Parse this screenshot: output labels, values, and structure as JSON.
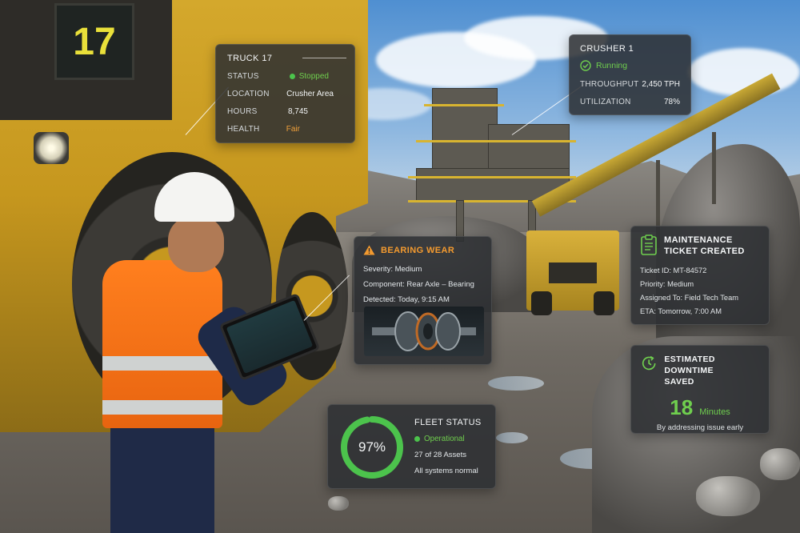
{
  "truck_plate": "17",
  "truck_panel": {
    "title": "TRUCK 17",
    "rows": [
      {
        "label": "STATUS",
        "value": "Stopped"
      },
      {
        "label": "LOCATION",
        "value": "Crusher Area"
      },
      {
        "label": "HOURS",
        "value": "8,745"
      },
      {
        "label": "HEALTH",
        "value": "Fair"
      }
    ]
  },
  "crusher_panel": {
    "title": "CRUSHER 1",
    "status": "Running",
    "rows": [
      {
        "label": "THROUGHPUT",
        "value": "2,450 TPH"
      },
      {
        "label": "UTILIZATION",
        "value": "78%"
      }
    ]
  },
  "bearing_panel": {
    "title": "BEARING WEAR",
    "lines": [
      "Severity: Medium",
      "Component: Rear Axle – Bearing",
      "Detected: Today, 9:15 AM"
    ]
  },
  "maintenance_panel": {
    "title_line1": "MAINTENANCE",
    "title_line2": "TICKET CREATED",
    "lines": [
      "Ticket ID: MT-84572",
      "Priority: Medium",
      "Assigned To: Field Tech Team",
      "ETA: Tomorrow, 7:00 AM"
    ]
  },
  "downtime_panel": {
    "title_line1": "ESTIMATED DOWNTIME",
    "title_line2": "SAVED",
    "value": "18",
    "unit": "Minutes",
    "note": "By addressing issue early"
  },
  "fleet_panel": {
    "percent_label": "97%",
    "percent_value": 0.97,
    "title": "FLEET STATUS",
    "status": "Operational",
    "assets": "27 of 28 Assets",
    "note": "All systems normal"
  },
  "colors": {
    "ok_green": "#4cc34c",
    "stopped_green": "#4cc34c",
    "warning_orange": "#f39a2f",
    "fair_orange": "#f0a03a",
    "panel_bg": "#2c2f32"
  },
  "icons": {
    "truck_status": "dot-icon",
    "crusher_status": "check-circle-icon",
    "bearing": "warning-triangle-icon",
    "maintenance": "clipboard-icon",
    "downtime": "clock-arrow-icon",
    "fleet": "progress-ring-icon"
  }
}
